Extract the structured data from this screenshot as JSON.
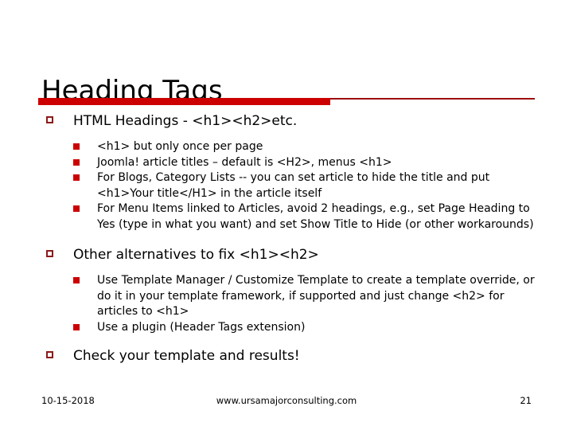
{
  "slide": {
    "title": "Heading Tags",
    "accent_color": "#cc0000",
    "accent_dark_color": "#8b1a1a",
    "background_color": "#ffffff",
    "text_color": "#000000"
  },
  "content": {
    "bullets": [
      {
        "level": 1,
        "text": "HTML Headings - <h1><h2>etc.",
        "bullet_glyph": "hollow-square"
      },
      {
        "level": 2,
        "text": "<h1> but only once per page",
        "bullet_glyph": "filled-square"
      },
      {
        "level": 2,
        "text": "Joomla! article titles – default is <H2>, menus <h1>",
        "bullet_glyph": "filled-square"
      },
      {
        "level": 2,
        "text": "For Blogs, Category Lists -- you can set article to hide the title and put",
        "continuation": "<h1>Your title</H1> in the article itself",
        "bullet_glyph": "filled-square"
      },
      {
        "level": 2,
        "text": "For Menu Items linked to Articles, avoid 2 headings, e.g., set Page Heading to Yes (type in what you want) and set Show Title to Hide (or other workarounds)",
        "bullet_glyph": "filled-square"
      },
      {
        "level": 1,
        "text": "Other alternatives to fix <h1><h2>",
        "bullet_glyph": "hollow-square"
      },
      {
        "level": 2,
        "text": "Use Template Manager / Customize Template to create a template override, or do it in your template framework, if supported and just change <h2> for articles to <h1>",
        "bullet_glyph": "filled-square"
      },
      {
        "level": 2,
        "text": "Use a plugin (Header Tags extension)",
        "bullet_glyph": "filled-square"
      },
      {
        "level": 1,
        "text": "Check your template and results!",
        "bullet_glyph": "hollow-square"
      }
    ]
  },
  "footer": {
    "date": "10-15-2018",
    "url": "www.ursamajorconsulting.com",
    "page_number": "21"
  }
}
